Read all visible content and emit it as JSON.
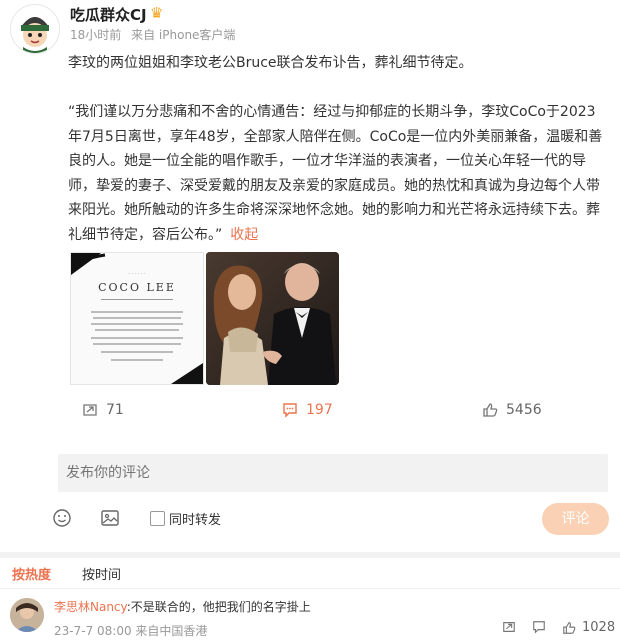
{
  "post": {
    "user_name": "吃瓜群众CJ",
    "crown_icon": "crown-icon",
    "time": "18小时前",
    "source": "来自 iPhone客户端",
    "paragraph1": "李玟的两位姐姐和李玟老公Bruce联合发布讣告，葬礼细节待定。",
    "paragraph2": "“我们谨以万分悲痛和不舍的心情通告：经过与抑郁症的长期斗争，李玟CoCo于2023年7月5日离世，享年48岁，全部家人陪伴在侧。CoCo是一位内外美丽兼备，温暖和善良的人。她是一位全能的唱作歌手，一位才华洋溢的表演者，一位关心年轻一代的导师，挚爱的妻子、深受爱戴的朋友及亲爱的家庭成员。她的热忱和真诚为身边每个人带来阳光。她所触动的许多生命将深深地怀念她。她的影响力和光芒将永远持续下去。葬礼细节待定，容后公布。”",
    "collapse_label": "收起"
  },
  "images": {
    "notice_title": "COCO LEE"
  },
  "actions": {
    "repost_count": "71",
    "comment_count": "197",
    "like_count": "5456"
  },
  "composer": {
    "placeholder": "发布你的评论",
    "repost_label": "同时转发",
    "submit_label": "评论"
  },
  "tabs": {
    "hot": "按热度",
    "time": "按时间"
  },
  "comment": {
    "user": "李思林Nancy",
    "text": ":不是联合的，他把我们的名字掛上",
    "meta": "23-7-7 08:00 来自中国香港",
    "like_count": "1028"
  },
  "colors": {
    "accent": "#eb7350",
    "button_disabled": "#fbd1b6"
  }
}
